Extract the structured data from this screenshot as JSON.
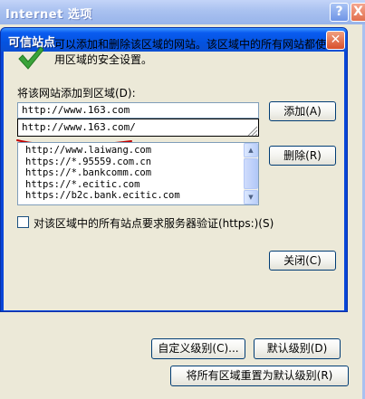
{
  "background_window": {
    "title": "Internet 选项",
    "help_button": "?",
    "close_button": "X",
    "custom_level_button": "自定义级别(C)...",
    "default_level_button": "默认级别(D)",
    "reset_all_button": "将所有区域重置为默认级别(R)"
  },
  "dialog": {
    "title": "可信站点",
    "close_button": "✕",
    "icon": "check-icon",
    "description": "可以添加和删除该区域的网站。该区域中的所有网站都使用区域的安全设置。",
    "add_label": "将该网站添加到区域(D):",
    "url_input_value": "http://www.163.com",
    "autocomplete_suggestion": "http://www.163.com/",
    "add_button": "添加(A)",
    "sites_label": "",
    "sites": [
      "http://www.laiwang.com",
      "https://*.95559.com.cn",
      "https://*.bankcomm.com",
      "https://*.ecitic.com",
      "https://b2c.bank.ecitic.com"
    ],
    "remove_button": "删除(R)",
    "https_checkbox_label": "对该区域中的所有站点要求服务器验证(https:)(S)",
    "https_checked": false,
    "close_dialog_button": "关闭(C)"
  },
  "colors": {
    "dialog_titlebar": "#0453e0",
    "background_titlebar": "#a9c1f0",
    "window_face": "#ece9d8",
    "annotation_red": "#c00000",
    "check_green": "#3aa33a"
  }
}
